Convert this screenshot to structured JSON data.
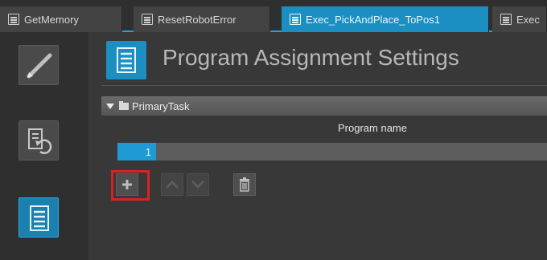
{
  "tabs": [
    {
      "label": "GetMemory"
    },
    {
      "label": "ResetRobotError"
    },
    {
      "label": "Exec_PickAndPlace_ToPos1"
    },
    {
      "label": "Exec"
    }
  ],
  "header": {
    "title": "Program Assignment Settings"
  },
  "task": {
    "name": "PrimaryTask"
  },
  "table": {
    "column_header": "Program name",
    "rows": [
      {
        "index": "1",
        "program": ""
      }
    ]
  },
  "toolbar": {
    "add_icon": "plus-icon",
    "move_up_icon": "chevron-up-icon",
    "move_down_icon": "chevron-down-icon",
    "delete_icon": "trash-icon"
  },
  "sidebar": {
    "icons": [
      "pencil-icon",
      "program-reset-icon",
      "program-list-icon"
    ]
  },
  "colors": {
    "accent": "#1b8ec2",
    "highlight": "#d8231f"
  }
}
